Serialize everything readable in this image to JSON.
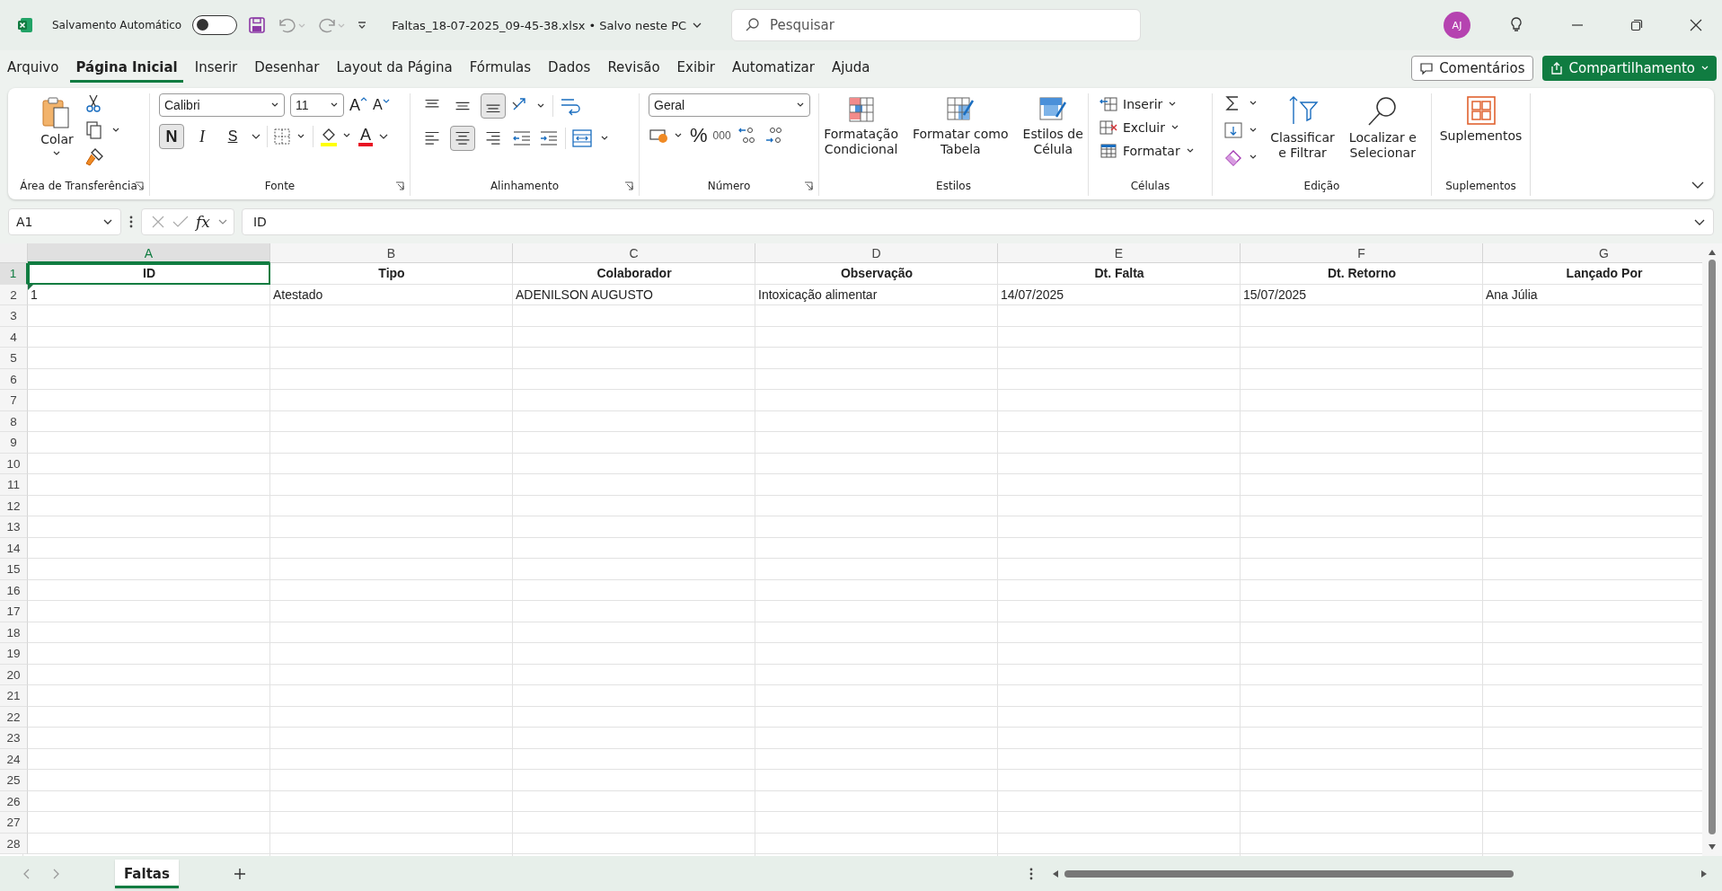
{
  "title_bar": {
    "autosave_label": "Salvamento Automático",
    "autosave_on": false,
    "file_name": "Faltas_18-07-2025_09-45-38.xlsx",
    "separator": "•",
    "save_status": "Salvo neste PC",
    "search_placeholder": "Pesquisar",
    "avatar_initials": "AJ"
  },
  "menu_tabs": [
    {
      "label": "Arquivo",
      "selected": false
    },
    {
      "label": "Página Inicial",
      "selected": true
    },
    {
      "label": "Inserir",
      "selected": false
    },
    {
      "label": "Desenhar",
      "selected": false
    },
    {
      "label": "Layout da Página",
      "selected": false
    },
    {
      "label": "Fórmulas",
      "selected": false
    },
    {
      "label": "Dados",
      "selected": false
    },
    {
      "label": "Revisão",
      "selected": false
    },
    {
      "label": "Exibir",
      "selected": false
    },
    {
      "label": "Automatizar",
      "selected": false
    },
    {
      "label": "Ajuda",
      "selected": false
    }
  ],
  "comments_button": "Comentários",
  "share_button": "Compartilhamento",
  "ribbon": {
    "clipboard": {
      "paste": "Colar",
      "group": "Área de Transferência"
    },
    "font": {
      "name": "Calibri",
      "size": "11",
      "grow": "A",
      "shrink": "A",
      "bold": {
        "label": "N",
        "selected": true
      },
      "italic": {
        "label": "I",
        "selected": false
      },
      "underline": {
        "label": "S",
        "selected": false
      },
      "font_color": "A",
      "group": "Fonte"
    },
    "alignment": {
      "vertical": [
        {
          "kind": "top",
          "selected": false
        },
        {
          "kind": "middle",
          "selected": false
        },
        {
          "kind": "bottom",
          "selected": true
        }
      ],
      "horizontal": [
        {
          "kind": "left",
          "selected": false
        },
        {
          "kind": "center",
          "selected": true
        },
        {
          "kind": "right",
          "selected": false
        }
      ],
      "group": "Alinhamento"
    },
    "number": {
      "format": "Geral",
      "percent": "%",
      "thousands": "000",
      "group": "Número"
    },
    "styles": {
      "buttons": [
        {
          "kind": "conditional",
          "lines": [
            "Formatação",
            "Condicional"
          ]
        },
        {
          "kind": "table",
          "lines": [
            "Formatar como",
            "Tabela"
          ]
        },
        {
          "kind": "cell",
          "lines": [
            "Estilos de",
            "Célula"
          ]
        }
      ],
      "group": "Estilos"
    },
    "cells": {
      "buttons": [
        {
          "kind": "insert",
          "label": "Inserir"
        },
        {
          "kind": "delete",
          "label": "Excluir"
        },
        {
          "kind": "format",
          "label": "Formatar"
        }
      ],
      "group": "Células"
    },
    "editing": {
      "buttons": [
        {
          "kind": "sort",
          "lines": [
            "Classificar",
            "e Filtrar"
          ]
        },
        {
          "kind": "find",
          "lines": [
            "Localizar e",
            "Selecionar"
          ]
        }
      ],
      "group": "Edição"
    },
    "addins": {
      "label": "Suplementos",
      "group": "Suplementos"
    }
  },
  "formula_bar": {
    "name_box": "A1",
    "function_label": "fx",
    "value": "ID"
  },
  "columns": [
    {
      "letter": "A",
      "selected": true
    },
    {
      "letter": "B",
      "selected": false
    },
    {
      "letter": "C",
      "selected": false
    },
    {
      "letter": "D",
      "selected": false
    },
    {
      "letter": "E",
      "selected": false
    },
    {
      "letter": "F",
      "selected": false
    },
    {
      "letter": "G",
      "selected": false
    }
  ],
  "rows": [
    {
      "number": "1",
      "selected": true,
      "kind": "header",
      "cells": [
        {
          "text": "ID",
          "active": true,
          "warning": false
        },
        {
          "text": "Tipo",
          "active": false,
          "warning": false
        },
        {
          "text": "Colaborador",
          "active": false,
          "warning": false
        },
        {
          "text": "Observação",
          "active": false,
          "warning": false
        },
        {
          "text": "Dt. Falta",
          "active": false,
          "warning": false
        },
        {
          "text": "Dt. Retorno",
          "active": false,
          "warning": false
        },
        {
          "text": "Lançado Por",
          "active": false,
          "warning": false
        }
      ]
    },
    {
      "number": "2",
      "selected": false,
      "kind": "data",
      "cells": [
        {
          "text": "1",
          "active": false,
          "warning": true
        },
        {
          "text": "Atestado",
          "active": false,
          "warning": false
        },
        {
          "text": "ADENILSON AUGUSTO",
          "active": false,
          "warning": false
        },
        {
          "text": "Intoxicação alimentar",
          "active": false,
          "warning": false
        },
        {
          "text": "14/07/2025",
          "active": false,
          "warning": false
        },
        {
          "text": "15/07/2025",
          "active": false,
          "warning": false
        },
        {
          "text": "Ana Júlia",
          "active": false,
          "warning": false
        }
      ]
    },
    {
      "number": "3",
      "selected": false
    },
    {
      "number": "4",
      "selected": false
    },
    {
      "number": "5",
      "selected": false
    },
    {
      "number": "6",
      "selected": false
    },
    {
      "number": "7",
      "selected": false
    },
    {
      "number": "8",
      "selected": false
    },
    {
      "number": "9",
      "selected": false
    },
    {
      "number": "10",
      "selected": false
    },
    {
      "number": "11",
      "selected": false
    },
    {
      "number": "12",
      "selected": false
    },
    {
      "number": "13",
      "selected": false
    },
    {
      "number": "14",
      "selected": false
    },
    {
      "number": "15",
      "selected": false
    },
    {
      "number": "16",
      "selected": false
    },
    {
      "number": "17",
      "selected": false
    },
    {
      "number": "18",
      "selected": false
    },
    {
      "number": "19",
      "selected": false
    },
    {
      "number": "20",
      "selected": false
    },
    {
      "number": "21",
      "selected": false
    },
    {
      "number": "22",
      "selected": false
    },
    {
      "number": "23",
      "selected": false
    },
    {
      "number": "24",
      "selected": false
    },
    {
      "number": "25",
      "selected": false
    },
    {
      "number": "26",
      "selected": false
    },
    {
      "number": "27",
      "selected": false
    },
    {
      "number": "28",
      "selected": false
    }
  ],
  "sheet_tabs": [
    {
      "label": "Faltas",
      "selected": true
    }
  ]
}
